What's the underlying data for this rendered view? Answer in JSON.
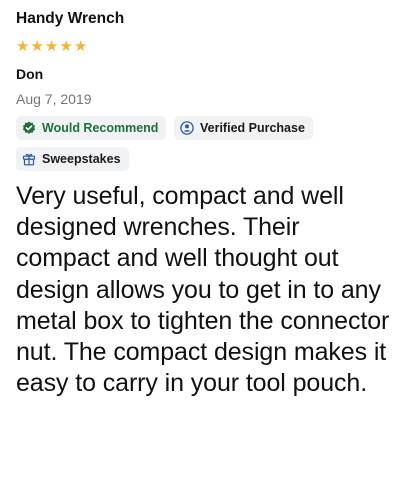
{
  "review": {
    "title": "Handy Wrench",
    "rating": 5,
    "stars": [
      "★",
      "★",
      "★",
      "★",
      "★"
    ],
    "author": "Don",
    "date": "Aug 7, 2019",
    "badges": {
      "recommend": "Would Recommend",
      "verified": "Verified Purchase",
      "sweepstakes": "Sweepstakes"
    },
    "body": "Very useful, compact and well designed wrenches. Their compact and well thought out design allows you to get in to any metal box to tighten the connector nut. The compact design makes it easy to carry in your tool pouch."
  },
  "colors": {
    "star": "#f4b331",
    "recommend": "#1f6f3d",
    "verified_icon": "#2c5aa0",
    "badge_bg": "#f1f2f4",
    "date": "#757575"
  },
  "icons": [
    "check-badge-icon",
    "user-badge-icon",
    "gift-icon"
  ]
}
